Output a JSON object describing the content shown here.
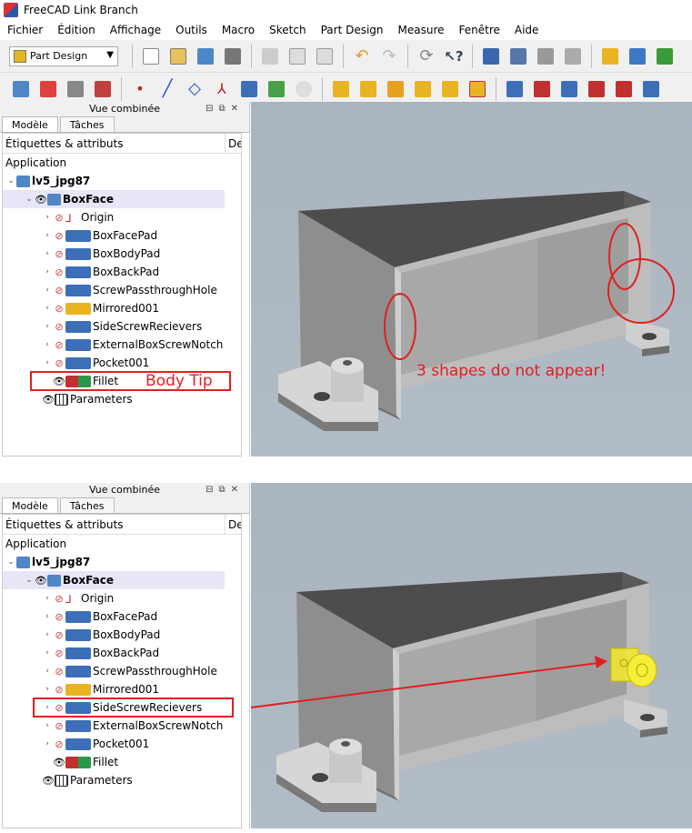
{
  "window": {
    "title": "FreeCAD Link Branch"
  },
  "menu": [
    "Fichier",
    "Édition",
    "Affichage",
    "Outils",
    "Macro",
    "Sketch",
    "Part Design",
    "Measure",
    "Fenêtre",
    "Aide"
  ],
  "toolbar": {
    "workbench": "Part Design"
  },
  "panel": {
    "title": "Vue combinée",
    "tabs": [
      "Modèle",
      "Tâches"
    ],
    "col1": "Étiquettes & attributs",
    "col2": "De"
  },
  "tree": {
    "root": "Application",
    "doc": "lv5_jpg87",
    "body": "BoxFace",
    "items": [
      "Origin",
      "BoxFacePad",
      "BoxBodyPad",
      "BoxBackPad",
      "ScrewPassthroughHole",
      "Mirrored001",
      "SideScrewRecievers",
      "ExternalBoxScrewNotch",
      "Pocket001",
      "Fillet"
    ],
    "params": "Parameters"
  },
  "annotations": {
    "body_tip": "Body Tip",
    "missing": "3 shapes do not appear!"
  },
  "colors": {
    "accent": "#e02020",
    "highlight": "#e6e6f7",
    "viewport": "#aeb8c3"
  }
}
